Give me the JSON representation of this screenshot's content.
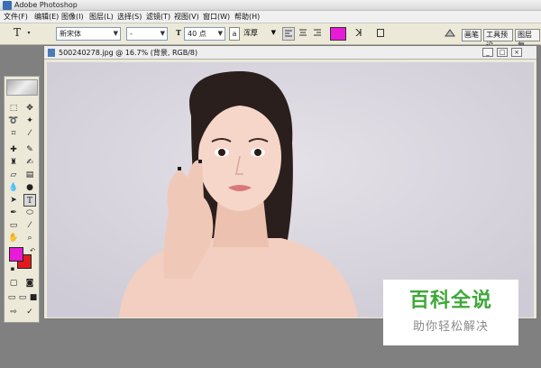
{
  "app": {
    "title": "Adobe Photoshop"
  },
  "menu": [
    "文件(F)",
    "编辑(E)",
    "图像(I)",
    "图层(L)",
    "选择(S)",
    "滤镜(T)",
    "视图(V)",
    "窗口(W)",
    "帮助(H)"
  ],
  "options": {
    "text_tool_icon": "T",
    "font_family": "新宋体",
    "font_style": "-",
    "size_icon": "T",
    "font_size": "40 点",
    "aa_icon": "a",
    "antialias": "浑厚",
    "text_color": "#e81bd8",
    "warp_icon": "warp-text-icon",
    "palette_icon": "palette-toggle-icon",
    "palette_tabs": [
      "画笔",
      "工具预设",
      "图层复"
    ]
  },
  "toolbox": {
    "foreground_color": "#e81bd8",
    "background_color": "#e11b1b"
  },
  "document": {
    "title": "500240278.jpg @ 16.7% (背景, RGB/8)",
    "btn_min": "_",
    "btn_max": "□",
    "btn_close": "×"
  },
  "watermark": {
    "main": "百科全说",
    "sub": "助你轻松解决",
    "color": "#3fa83a"
  }
}
